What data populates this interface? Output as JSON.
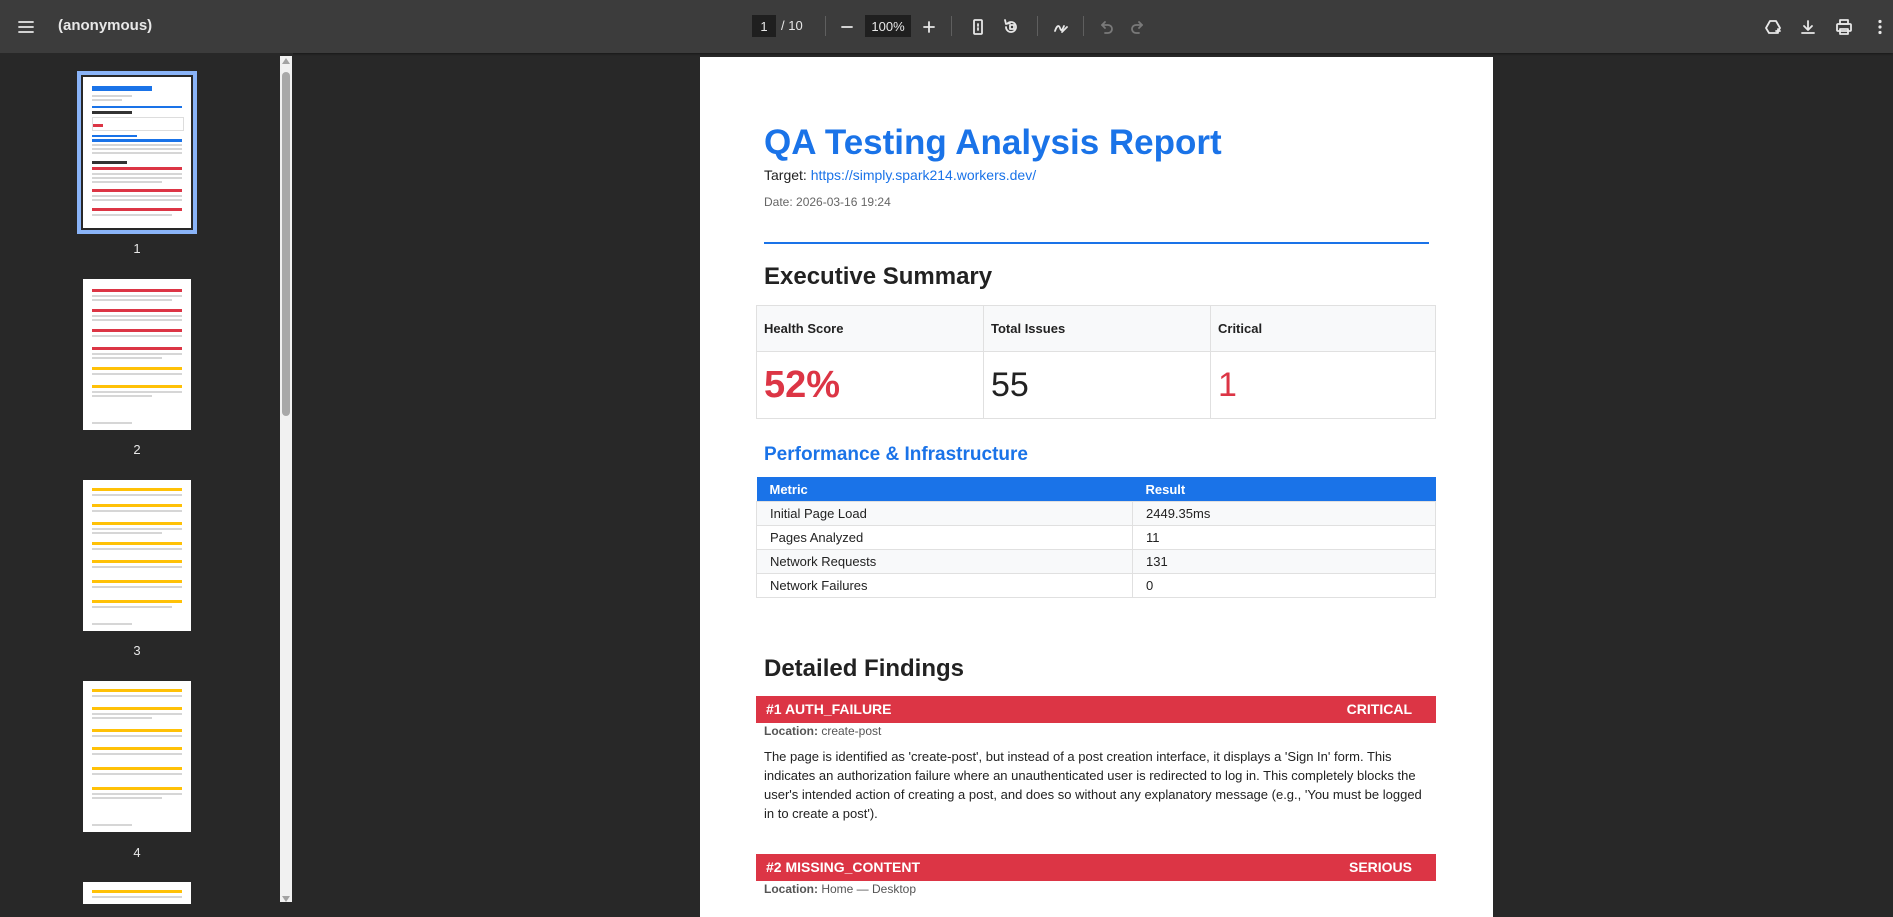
{
  "toolbar": {
    "title": "(anonymous)",
    "page_current": "1",
    "page_total": "/ 10",
    "zoom": "100%"
  },
  "thumbnails": [
    {
      "number": "1"
    },
    {
      "number": "2"
    },
    {
      "number": "3"
    },
    {
      "number": "4"
    }
  ],
  "report": {
    "title": "QA Testing Analysis Report",
    "target_label": "Target: ",
    "target_url": "https://simply.spark214.workers.dev/",
    "date": "Date: 2026-03-16 19:24",
    "executive_summary": {
      "heading": "Executive Summary",
      "labels": [
        "Health Score",
        "Total Issues",
        "Critical"
      ],
      "values": [
        "52%",
        "55",
        "1"
      ]
    },
    "performance": {
      "heading": "Performance & Infrastructure",
      "columns": [
        "Metric",
        "Result"
      ],
      "rows": [
        [
          "Initial Page Load",
          "2449.35ms"
        ],
        [
          "Pages Analyzed",
          "11"
        ],
        [
          "Network Requests",
          "131"
        ],
        [
          "Network Failures",
          "0"
        ]
      ]
    },
    "findings": {
      "heading": "Detailed Findings",
      "location_label": "Location:",
      "items": [
        {
          "id": "#1 AUTH_FAILURE",
          "severity": "CRITICAL",
          "location": " create-post",
          "text": "The page is identified as 'create-post', but instead of a post creation interface, it displays a 'Sign In' form. This indicates an authorization failure where an unauthenticated user is redirected to log in. This completely blocks the user's intended action of creating a post, and does so without any explanatory message (e.g., 'You must be logged in to create a post')."
        },
        {
          "id": "#2 MISSING_CONTENT",
          "severity": "SERIOUS",
          "location": " Home — Desktop",
          "text": ""
        }
      ]
    }
  },
  "colors": {
    "accent": "#1a73e8",
    "critical": "#dc3545",
    "warning": "#ffc107",
    "toolbar_bg": "#3c3c3c",
    "viewer_bg": "#282828"
  }
}
